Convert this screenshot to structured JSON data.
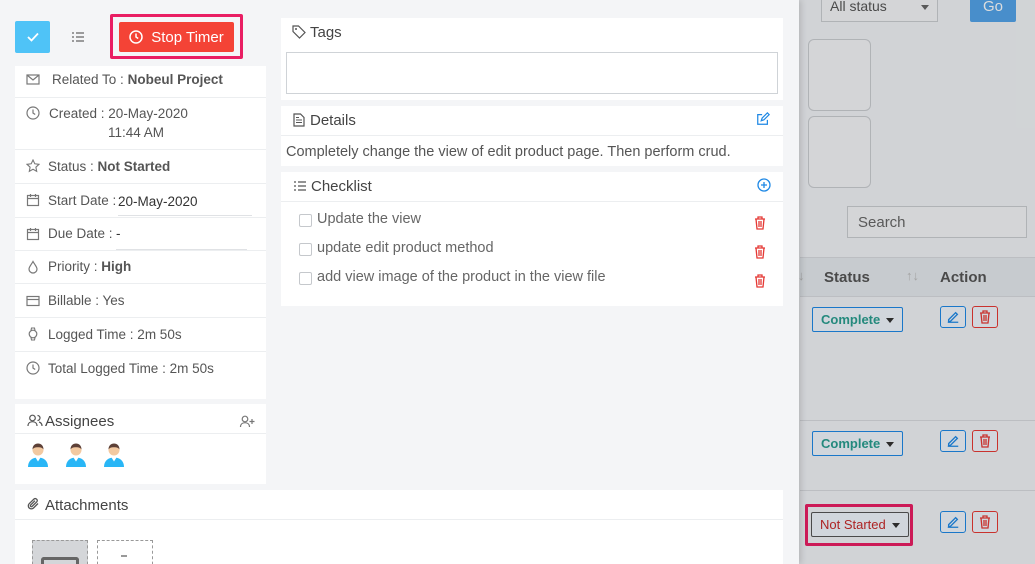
{
  "background": {
    "status_filter": "All status",
    "go_label": "Go",
    "search_placeholder": "Search",
    "columns": {
      "status": "Status",
      "action": "Action"
    },
    "rows": [
      {
        "status": "Complete"
      },
      {
        "status": "Complete"
      },
      {
        "status": "Not Started"
      }
    ]
  },
  "toolbar": {
    "stop_timer_label": "Stop Timer"
  },
  "info": {
    "related_label": "Related To :",
    "related_value": "Nobeul Project",
    "created_label": "Created :",
    "created_date": "20-May-2020",
    "created_time": "11:44 AM",
    "status_label": "Status :",
    "status_value": "Not Started",
    "start_label": "Start Date :",
    "start_value": "20-May-2020",
    "due_label": "Due Date :",
    "due_value": "-",
    "priority_label": "Priority :",
    "priority_value": "High",
    "billable_label": "Billable : Yes",
    "logged_label": "Logged Time : 2m 50s",
    "total_label": "Total Logged Time : 2m 50s"
  },
  "assignees": {
    "title": "Assignees",
    "count": 3
  },
  "tags": {
    "title": "Tags"
  },
  "details": {
    "title": "Details",
    "text": "Completely change the view of edit product page. Then perform crud."
  },
  "checklist": {
    "title": "Checklist",
    "items": [
      "Update the view",
      "update edit product method",
      "add view image of the product in the view file"
    ]
  },
  "attachments": {
    "title": "Attachments"
  },
  "colors": {
    "stop_timer": "#f44336",
    "highlight": "#e91e63",
    "check_button": "#4fc3f7",
    "link_blue": "#1e88e5",
    "danger": "#e53935"
  }
}
